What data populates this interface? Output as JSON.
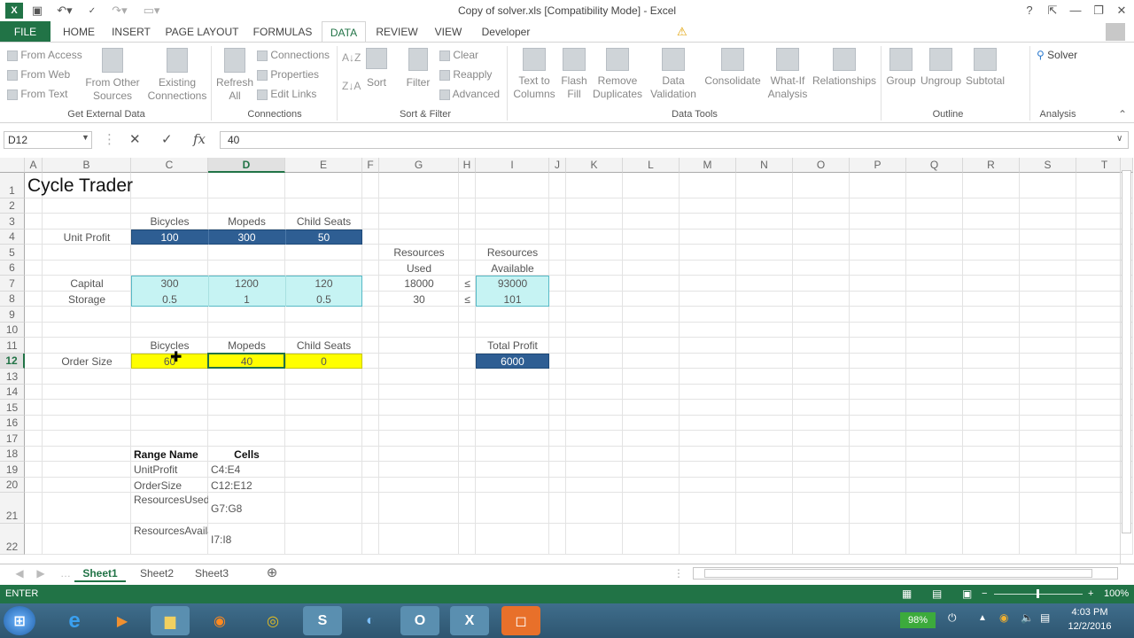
{
  "window": {
    "title": "Copy of solver.xls  [Compatibility Mode] - Excel",
    "help": "?",
    "min": "—",
    "restore": "❐",
    "close": "✕"
  },
  "tabs": {
    "file": "FILE",
    "home": "HOME",
    "insert": "INSERT",
    "page_layout": "PAGE LAYOUT",
    "formulas": "FORMULAS",
    "data": "DATA",
    "review": "REVIEW",
    "view": "VIEW",
    "developer": "Developer"
  },
  "ribbon": {
    "get_external": {
      "from_access": "From Access",
      "from_web": "From Web",
      "from_text": "From Text",
      "from_other": "From Other\nSources",
      "existing": "Existing\nConnections",
      "group": "Get External Data"
    },
    "connections": {
      "refresh": "Refresh\nAll",
      "connections": "Connections",
      "properties": "Properties",
      "edit_links": "Edit Links",
      "group": "Connections"
    },
    "sort_filter": {
      "sort": "Sort",
      "filter": "Filter",
      "clear": "Clear",
      "reapply": "Reapply",
      "advanced": "Advanced",
      "group": "Sort & Filter"
    },
    "data_tools": {
      "text_to_columns": "Text to\nColumns",
      "flash_fill": "Flash\nFill",
      "remove_dup": "Remove\nDuplicates",
      "data_validation": "Data\nValidation",
      "consolidate": "Consolidate",
      "what_if": "What-If\nAnalysis",
      "relationships": "Relationships",
      "group": "Data Tools"
    },
    "outline": {
      "group_btn": "Group",
      "ungroup": "Ungroup",
      "subtotal": "Subtotal",
      "group": "Outline"
    },
    "analysis": {
      "solver": "Solver",
      "group": "Analysis"
    }
  },
  "formula_bar": {
    "name_box": "D12",
    "value": "40"
  },
  "grid": {
    "columns": [
      "A",
      "B",
      "C",
      "D",
      "E",
      "F",
      "G",
      "H",
      "I",
      "J",
      "K",
      "L",
      "M",
      "N",
      "O",
      "P",
      "Q",
      "R",
      "S",
      "T"
    ],
    "rows": [
      "1",
      "2",
      "3",
      "4",
      "5",
      "6",
      "7",
      "8",
      "9",
      "10",
      "11",
      "12",
      "13",
      "14",
      "15",
      "16",
      "17",
      "18",
      "19",
      "20",
      "21",
      "22"
    ],
    "selected_col": "D",
    "selected_row": "12",
    "cells": {
      "A1": "Cycle Trader",
      "C3": "Bicycles",
      "D3": "Mopeds",
      "E3": "Child Seats",
      "B4": "Unit Profit",
      "C4": "100",
      "D4": "300",
      "E4": "50",
      "G5": "Resources",
      "I5": "Resources",
      "G6": "Used",
      "I6": "Available",
      "B7": "Capital",
      "C7": "300",
      "D7": "1200",
      "E7": "120",
      "G7": "18000",
      "H7": "≤",
      "I7": "93000",
      "B8": "Storage",
      "C8": "0.5",
      "D8": "1",
      "E8": "0.5",
      "G8": "30",
      "H8": "≤",
      "I8": "101",
      "C11": "Bicycles",
      "D11": "Mopeds",
      "E11": "Child Seats",
      "I11": "Total Profit",
      "B12": "Order Size",
      "C12": "60",
      "D12": "40",
      "E12": "0",
      "I12": "6000",
      "C18": "Range Name",
      "D18": "Cells",
      "C19": "UnitProfit",
      "D19": "C4:E4",
      "C20": "OrderSize",
      "D20": "C12:E12",
      "C21": "ResourcesUsed",
      "D21": "G7:G8",
      "C22": "ResourcesAvailable",
      "D22": "I7:I8"
    }
  },
  "sheets": [
    "Sheet1",
    "Sheet2",
    "Sheet3"
  ],
  "active_sheet": "Sheet1",
  "status": {
    "mode": "ENTER",
    "zoom": "100%"
  },
  "taskbar": {
    "battery": "98%",
    "time": "4:03 PM",
    "date": "12/2/2016"
  }
}
